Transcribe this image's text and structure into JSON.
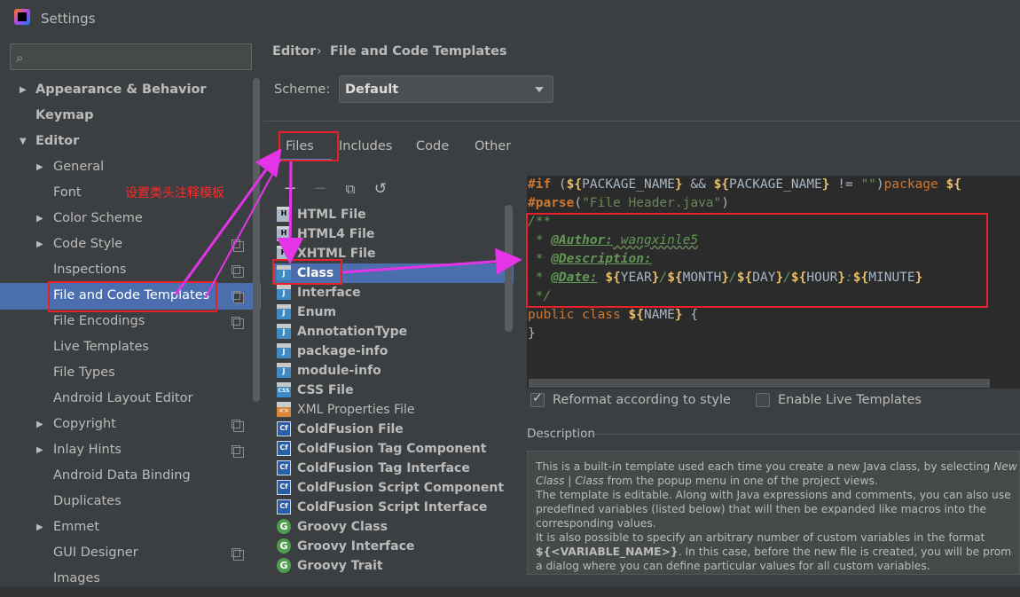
{
  "window": {
    "title": "Settings"
  },
  "search": {
    "placeholder": ""
  },
  "sidebar": {
    "items": [
      {
        "label": "Appearance & Behavior"
      },
      {
        "label": "Keymap"
      },
      {
        "label": "Editor"
      },
      {
        "label": "General"
      },
      {
        "label": "Font"
      },
      {
        "label": "Color Scheme"
      },
      {
        "label": "Code Style"
      },
      {
        "label": "Inspections"
      },
      {
        "label": "File and Code Templates"
      },
      {
        "label": "File Encodings"
      },
      {
        "label": "Live Templates"
      },
      {
        "label": "File Types"
      },
      {
        "label": "Android Layout Editor"
      },
      {
        "label": "Copyright"
      },
      {
        "label": "Inlay Hints"
      },
      {
        "label": "Android Data Binding"
      },
      {
        "label": "Duplicates"
      },
      {
        "label": "Emmet"
      },
      {
        "label": "GUI Designer"
      },
      {
        "label": "Images"
      }
    ]
  },
  "breadcrumb": {
    "section": "Editor",
    "separator": "›",
    "page": "File and Code Templates"
  },
  "scheme": {
    "label": "Scheme:",
    "value": "Default"
  },
  "tabs": [
    {
      "label": "Files"
    },
    {
      "label": "Includes"
    },
    {
      "label": "Code"
    },
    {
      "label": "Other"
    }
  ],
  "templates": [
    {
      "label": "HTML File",
      "icon": "H"
    },
    {
      "label": "HTML4 File",
      "icon": "H"
    },
    {
      "label": "XHTML File",
      "icon": "H"
    },
    {
      "label": "Class",
      "icon": "J"
    },
    {
      "label": "Interface",
      "icon": "J"
    },
    {
      "label": "Enum",
      "icon": "J"
    },
    {
      "label": "AnnotationType",
      "icon": "J"
    },
    {
      "label": "package-info",
      "icon": "J"
    },
    {
      "label": "module-info",
      "icon": "J"
    },
    {
      "label": "CSS File",
      "icon": "CSS"
    },
    {
      "label": "XML Properties File",
      "icon": "<>"
    },
    {
      "label": "ColdFusion File",
      "icon": "Cf"
    },
    {
      "label": "ColdFusion Tag Component",
      "icon": "Cf"
    },
    {
      "label": "ColdFusion Tag Interface",
      "icon": "Cf"
    },
    {
      "label": "ColdFusion Script Component",
      "icon": "Cf"
    },
    {
      "label": "ColdFusion Script Interface",
      "icon": "Cf"
    },
    {
      "label": "Groovy Class",
      "icon": "G"
    },
    {
      "label": "Groovy Interface",
      "icon": "G"
    },
    {
      "label": "Groovy Trait",
      "icon": "G"
    }
  ],
  "editor": {
    "line1": {
      "a": "#if",
      "b": " (",
      "c": "${",
      "d": "PACKAGE_NAME",
      "e": "}",
      "f": " && ",
      "g": "${",
      "h": "PACKAGE_NAME",
      "i": "}",
      "j": " != ",
      "k": "\"\"",
      "l": ")",
      "m": "package ",
      "n": "${"
    },
    "line2": {
      "a": "#parse",
      "b": "(",
      "c": "\"File Header.java\"",
      "d": ")"
    },
    "line3": "/**",
    "line4": {
      "prefix": " * ",
      "tag": "@Author:",
      "value": " wangxinle5"
    },
    "line5": {
      "prefix": " * ",
      "tag": "@Description:"
    },
    "line6": {
      "prefix": " * ",
      "tag": "@Date:",
      "v1": "YEAR",
      "v2": "MONTH",
      "v3": "DAY",
      "v4": "HOUR",
      "v5": "MINUTE",
      "slash": "/",
      "colon": ":",
      "open": "${",
      "close": "}"
    },
    "line7": " */",
    "line8": {
      "a": "public class ",
      "open": "${",
      "name": "NAME",
      "close": "}",
      "end": " {"
    },
    "line9": "}"
  },
  "options": {
    "reformat": "Reformat according to style",
    "live": "Enable Live Templates"
  },
  "description": {
    "title": "Description",
    "lines": [
      "This is a built-in template used each time you create a new Java class, by selecting ",
      " | ",
      " from the popup menu in one of the project views.",
      "The template is editable. Along with Java expressions and comments, you can also use",
      "predefined variables (listed below) that will then be expanded like macros into the",
      "corresponding values.",
      "It is also possible to specify an arbitrary number of custom variables in the format",
      "${<VARIABLE_NAME>}",
      ". In this case, before the new file is created, you will be prom",
      "a dialog where you can define particular values for all custom variables."
    ],
    "italic_new": "New",
    "italic_class": "Class",
    "italic_class2": "Class"
  },
  "annotation": {
    "note": "设置类头注释模板"
  },
  "colors": {
    "accent": "#4b6eaf",
    "annotation_red": "#e8202a",
    "arrow_magenta": "#e533e8"
  }
}
